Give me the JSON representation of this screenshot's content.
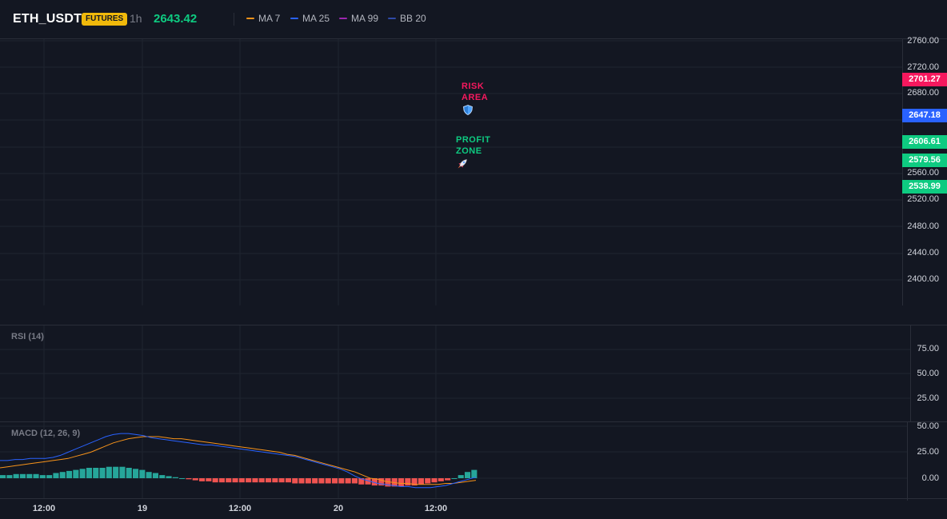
{
  "header": {
    "symbol": "ETH_USDT",
    "badge": "FUTURES",
    "interval": "1h",
    "price": "2643.42",
    "legend": [
      {
        "label": "MA 7",
        "color": "#f7931a"
      },
      {
        "label": "MA 25",
        "color": "#2962ff"
      },
      {
        "label": "MA 99",
        "color": "#9c27b0"
      },
      {
        "label": "BB 20",
        "color": "#1e3a8a"
      }
    ]
  },
  "price_axis": {
    "ticks": [
      "2760.00",
      "2720.00",
      "2680.00",
      "2560.00",
      "2520.00",
      "2480.00",
      "2440.00",
      "2400.00"
    ],
    "markers": [
      {
        "label": "2701.27",
        "color": "#f6185e"
      },
      {
        "label": "2647.18",
        "color": "#2962ff"
      },
      {
        "label": "2606.61",
        "color": "#0ecb81"
      },
      {
        "label": "2579.56",
        "color": "#0ecb81"
      },
      {
        "label": "2538.99",
        "color": "#0ecb81"
      }
    ]
  },
  "annotations": {
    "risk": {
      "line1": "RISK",
      "line2": "AREA",
      "color": "#f6185e",
      "icon": "shield-icon"
    },
    "profit": {
      "line1": "PROFIT",
      "line2": "ZONE",
      "color": "#0ecb81",
      "icon": "rocket-icon"
    }
  },
  "rsi": {
    "label": "RSI (14)",
    "ticks": [
      "75.00",
      "50.00",
      "25.00"
    ]
  },
  "macd": {
    "label": "MACD (12, 26, 9)",
    "ticks": [
      "50.00",
      "25.00",
      "0.00"
    ]
  },
  "time_axis": {
    "labels": [
      "12:00",
      "19",
      "12:00",
      "20",
      "12:00"
    ]
  },
  "chart_data": {
    "type": "line",
    "title": "",
    "macd_line": [
      17,
      17,
      18,
      18,
      19,
      19,
      19,
      20,
      22,
      25,
      28,
      31,
      34,
      37,
      40,
      42,
      43,
      43,
      42,
      41,
      39,
      38,
      37,
      36,
      35,
      34,
      33,
      32,
      32,
      31,
      30,
      29,
      28,
      27,
      26,
      25,
      24,
      23,
      22,
      21,
      19,
      17,
      15,
      13,
      11,
      9,
      6,
      2,
      -1,
      -3,
      -5,
      -6,
      -7,
      -8,
      -8,
      -9,
      -9,
      -9,
      -8,
      -7,
      -5,
      -3,
      -1,
      1
    ],
    "signal_line": [
      10,
      11,
      12,
      13,
      14,
      15,
      16,
      17,
      18,
      19,
      21,
      23,
      25,
      28,
      31,
      34,
      36,
      38,
      39,
      40,
      40,
      40,
      39,
      38,
      38,
      37,
      36,
      35,
      34,
      33,
      32,
      31,
      30,
      29,
      28,
      27,
      26,
      25,
      23,
      22,
      20,
      18,
      16,
      14,
      12,
      10,
      8,
      6,
      3,
      0,
      -1,
      -3,
      -4,
      -5,
      -5,
      -6,
      -6,
      -6,
      -6,
      -5,
      -5,
      -4,
      -3,
      -2
    ],
    "histogram": [
      3,
      3,
      4,
      4,
      4,
      4,
      3,
      3,
      5,
      6,
      7,
      8,
      9,
      10,
      10,
      10,
      11,
      11,
      11,
      10,
      9,
      8,
      6,
      5,
      3,
      2,
      1,
      0,
      -1,
      -2,
      -3,
      -3,
      -4,
      -4,
      -4,
      -4,
      -4,
      -4,
      -4,
      -4,
      -4,
      -4,
      -4,
      -4,
      -5,
      -5,
      -5,
      -5,
      -5,
      -5,
      -5,
      -5,
      -5,
      -5,
      -6,
      -6,
      -7,
      -7,
      -8,
      -8,
      -8,
      -7,
      -7,
      -6,
      -5,
      -4,
      -3,
      -2,
      0,
      3,
      6,
      8
    ]
  }
}
